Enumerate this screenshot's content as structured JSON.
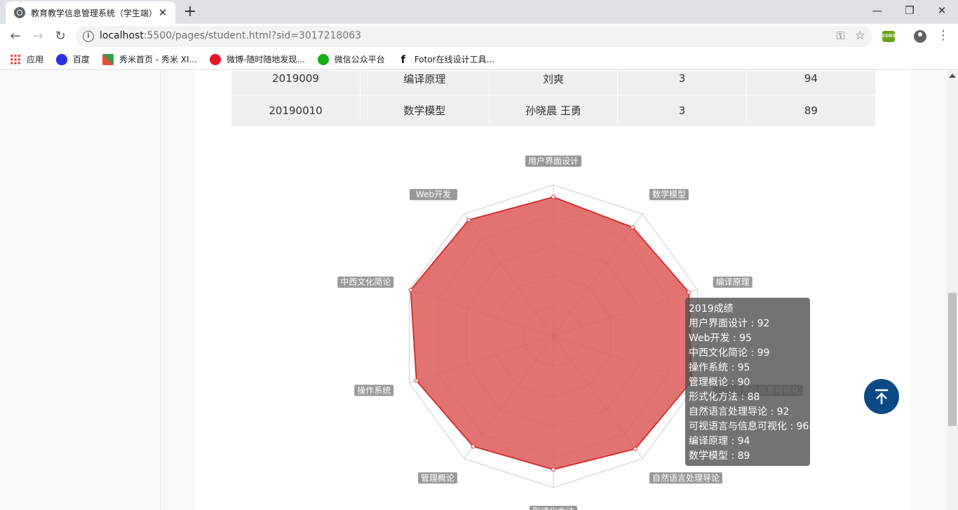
{
  "browser": {
    "tab_title": "教育教学信息管理系统（学生端）",
    "tab_close": "✕",
    "new_tab": "+",
    "url_host": "localhost",
    "url_rest": ":5500/pages/student.html?sid=3017218063",
    "window_controls": [
      "—",
      "❐",
      "✕"
    ]
  },
  "bookmarks": [
    {
      "label": "应用",
      "icon": "apps-icon"
    },
    {
      "label": "百度",
      "icon": "baidu-icon"
    },
    {
      "label": "秀米首页 - 秀米 XI...",
      "icon": "xiumi-icon"
    },
    {
      "label": "微博-随时随地发现...",
      "icon": "weibo-icon"
    },
    {
      "label": "微信公众平台",
      "icon": "wechat-icon"
    },
    {
      "label": "Fotor在线设计工具...",
      "icon": "fotor-icon"
    }
  ],
  "grades_table": {
    "rows": [
      [
        "2019009",
        "编译原理",
        "刘爽",
        "3",
        "94"
      ],
      [
        "20190010",
        "数学模型",
        "孙晓晨 王勇",
        "3",
        "89"
      ]
    ]
  },
  "chart_data": {
    "type": "radar",
    "series": [
      {
        "name": "2019成绩",
        "values": [
          92,
          89,
          94,
          96,
          92,
          88,
          90,
          95,
          99,
          95
        ]
      }
    ],
    "indicators": [
      "用户界面设计",
      "数学模型",
      "编译原理",
      "可视语言与信息可视化",
      "自然语言处理导论",
      "形式化方法",
      "管理概论",
      "操作系统",
      "中西文化简论",
      "Web开发"
    ],
    "max": 100,
    "rings": 5,
    "fill_color": "#dd5b57",
    "line_color": "#d23431"
  },
  "tooltip": {
    "title": "2019成绩",
    "lines": [
      "用户界面设计 : 92",
      "Web开发 : 95",
      "中西文化简论 : 99",
      "操作系统 : 95",
      "管理概论 : 90",
      "形式化方法 : 88",
      "自然语言处理导论 : 92",
      "可视语言与信息可视化 : 96",
      "编译原理 : 94",
      "数学模型 : 89"
    ]
  }
}
